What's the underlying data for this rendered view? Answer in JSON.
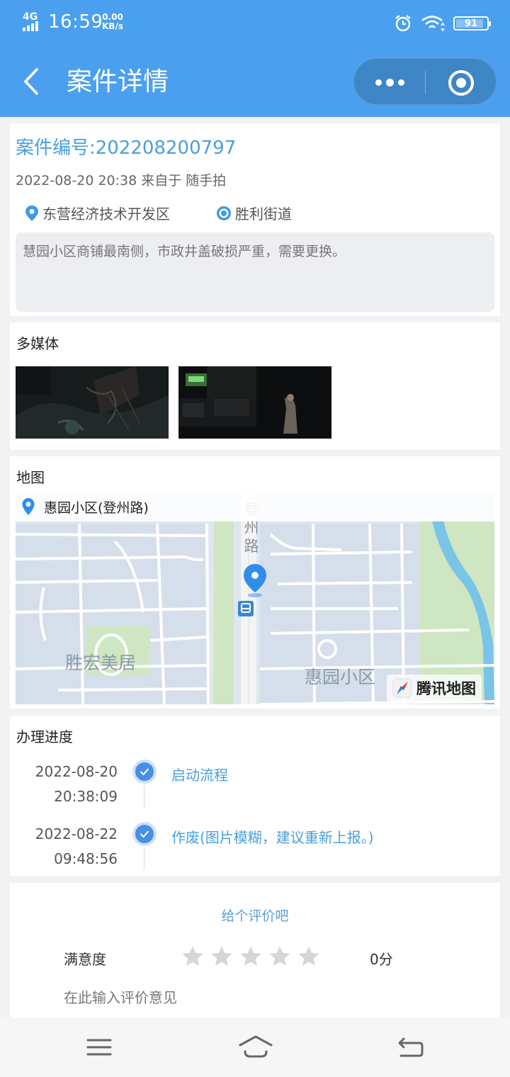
{
  "status_bar": {
    "network": "4G",
    "time": "16:59",
    "speed_value": "0.00",
    "speed_unit": "KB/s",
    "battery": "91",
    "battery_level": 0.91
  },
  "header": {
    "title": "案件详情"
  },
  "case": {
    "number_label": "案件编号:202208200797",
    "meta": "2022-08-20 20:38 来自于 随手拍",
    "district": "东营经济技术开发区",
    "street": "胜利街道",
    "description": "慧园小区商铺最南侧，市政井盖破损严重，需要更换。"
  },
  "media": {
    "title": "多媒体"
  },
  "map": {
    "title": "地图",
    "address": "惠园小区(登州路)",
    "road_label": "登州路",
    "area_label_1": "胜宏美居",
    "area_label_2": "惠园小区",
    "provider": "腾讯地图"
  },
  "progress": {
    "title": "办理进度",
    "steps": [
      {
        "date": "2022-08-20",
        "time": "20:38:09",
        "text": "启动流程"
      },
      {
        "date": "2022-08-22",
        "time": "09:48:56",
        "text": "作废(图片模糊，建议重新上报。)"
      }
    ]
  },
  "rating": {
    "title": "给个评价吧",
    "label": "满意度",
    "stars_filled": 0,
    "stars_total": 5,
    "score": "0分",
    "comment_placeholder": "在此输入评价意见"
  },
  "colors": {
    "header": "#4aa0ee",
    "accent": "#4a9fdc",
    "timeline_dot": "#4a8fe6"
  }
}
